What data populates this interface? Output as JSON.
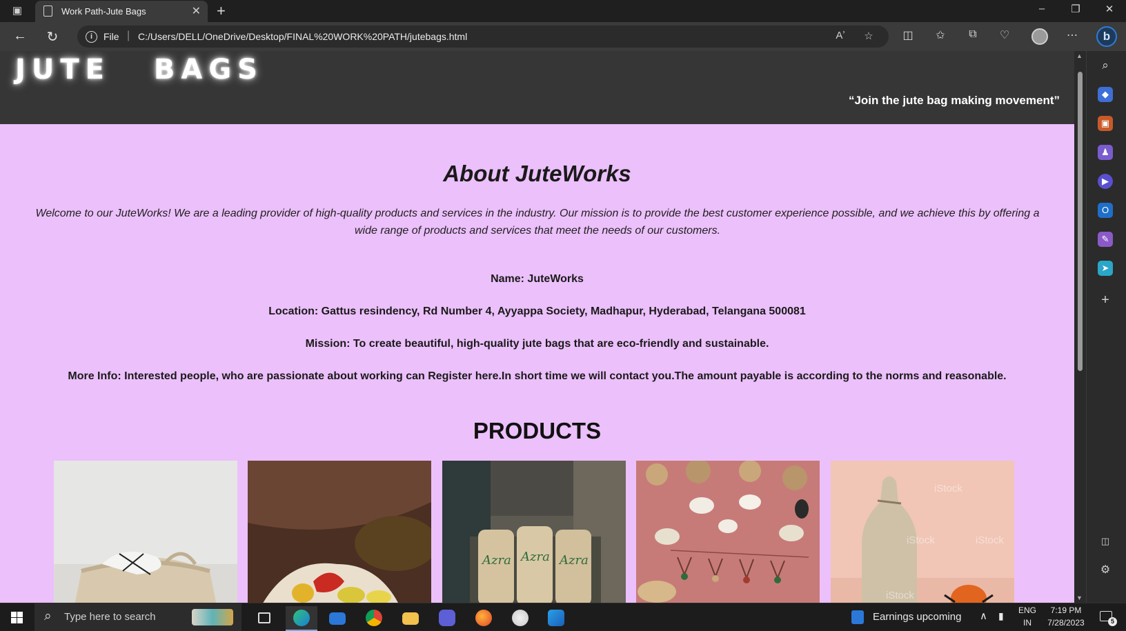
{
  "browser": {
    "tab_title": "Work Path-Jute Bags",
    "address_scheme": "File",
    "address_url": "C:/Users/DELL/OneDrive/Desktop/FINAL%20WORK%20PATH/jutebags.html"
  },
  "site": {
    "logo": "JUTE BAGS",
    "tagline": "“Join the jute bag making movement”"
  },
  "about": {
    "title": "About JuteWorks",
    "welcome": "Welcome to our JuteWorks! We are a leading provider of high-quality products and services in the industry. Our mission is to provide the best customer experience possible, and we achieve this by offering a wide range of products and services that meet the needs of our customers.",
    "name": "Name: JuteWorks",
    "location": "Location: Gattus resindency, Rd Number 4, Ayyappa Society, Madhapur, Hyderabad, Telangana 500081",
    "mission": "Mission: To create beautiful, high-quality jute bags that are eco-friendly and sustainable.",
    "more_info": "More Info: Interested people, who are passionate about working can Register here.In short time we will contact you.The amount payable is according to the norms and reasonable."
  },
  "products": {
    "title": "PRODUCTS",
    "images": [
      {
        "name": "product-image-rope-basket"
      },
      {
        "name": "product-image-produce-bag"
      },
      {
        "name": "product-image-jute-sacks",
        "text": "Azra"
      },
      {
        "name": "product-image-jute-crafts"
      },
      {
        "name": "product-image-bottle-bag",
        "text": "iStock"
      }
    ]
  },
  "taskbar": {
    "search_placeholder": "Type here to search",
    "widget_text": "Earnings upcoming",
    "lang_top": "ENG",
    "lang_bottom": "IN",
    "time": "7:19 PM",
    "date": "7/28/2023",
    "notification_count": "5"
  },
  "colors": {
    "page_background": "#ecc0fb",
    "header_background": "#363636"
  }
}
